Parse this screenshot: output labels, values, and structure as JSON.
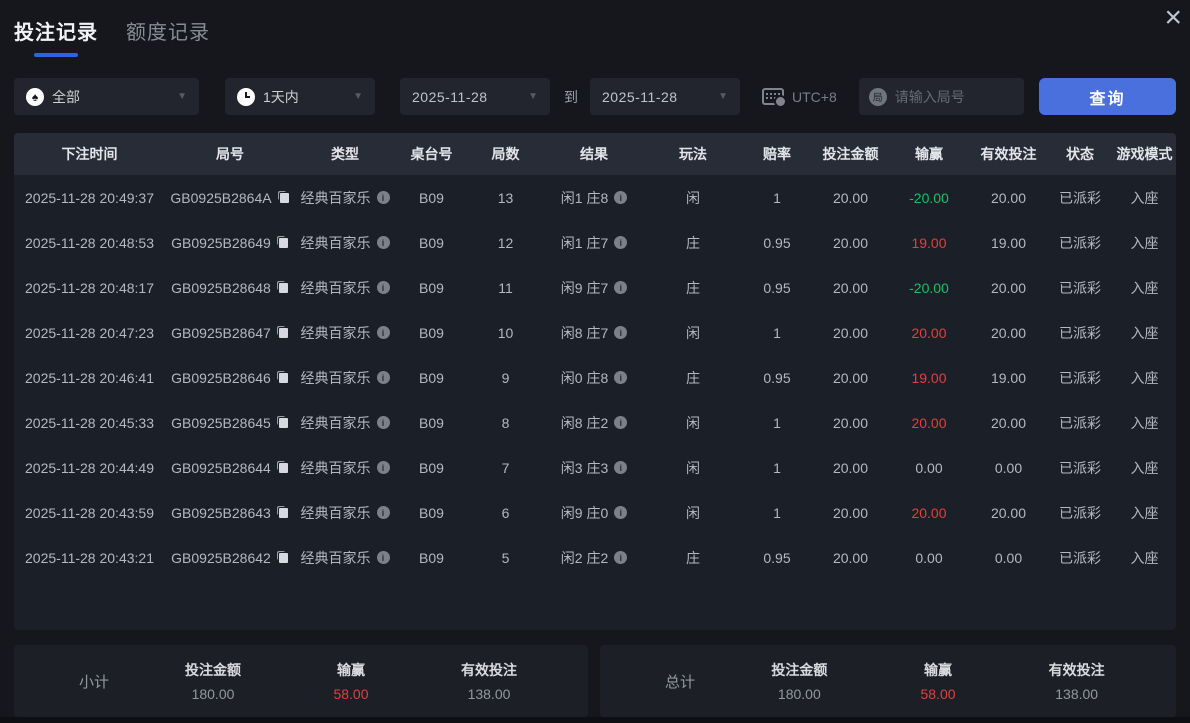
{
  "colors": {
    "accent_blue": "#4a70dd",
    "tab_underline": "#2e63e8",
    "win_red": "#e0413e",
    "loss_green": "#0fc367",
    "page_bg": "#16171d",
    "panel_bg": "#1b1f28",
    "header_bg": "#282c37"
  },
  "window": {
    "close_glyph": "×"
  },
  "tabs": [
    {
      "label": "投注记录",
      "active": true
    },
    {
      "label": "额度记录",
      "active": false
    }
  ],
  "filters": {
    "game_type": {
      "icon_glyph": "♠",
      "value": "全部"
    },
    "time_range": {
      "value": "1天内"
    },
    "date_from": "2025-11-28",
    "to_label": "到",
    "date_to": "2025-11-28",
    "timezone_label": "UTC+8",
    "round_input": {
      "badge_glyph": "局",
      "placeholder": "请输入局号",
      "value": ""
    },
    "query_button": "查询",
    "caret_glyph": "▼",
    "info_glyph": "i"
  },
  "table": {
    "columns": [
      "下注时间",
      "局号",
      "类型",
      "桌台号",
      "局数",
      "结果",
      "玩法",
      "赔率",
      "投注金额",
      "输赢",
      "有效投注",
      "状态",
      "游戏模式"
    ],
    "rows": [
      {
        "time": "2025-11-28 20:49:37",
        "round_id": "GB0925B2864A",
        "type": "经典百家乐",
        "table_no": "B09",
        "round_no": "13",
        "result": "闲1 庄8",
        "play": "闲",
        "odds": "1",
        "bet": "20.00",
        "win_loss": "-20.00",
        "win_loss_color": "green",
        "valid_bet": "20.00",
        "status": "已派彩",
        "mode": "入座"
      },
      {
        "time": "2025-11-28 20:48:53",
        "round_id": "GB0925B28649",
        "type": "经典百家乐",
        "table_no": "B09",
        "round_no": "12",
        "result": "闲1 庄7",
        "play": "庄",
        "odds": "0.95",
        "bet": "20.00",
        "win_loss": "19.00",
        "win_loss_color": "red",
        "valid_bet": "19.00",
        "status": "已派彩",
        "mode": "入座"
      },
      {
        "time": "2025-11-28 20:48:17",
        "round_id": "GB0925B28648",
        "type": "经典百家乐",
        "table_no": "B09",
        "round_no": "11",
        "result": "闲9 庄7",
        "play": "庄",
        "odds": "0.95",
        "bet": "20.00",
        "win_loss": "-20.00",
        "win_loss_color": "green",
        "valid_bet": "20.00",
        "status": "已派彩",
        "mode": "入座"
      },
      {
        "time": "2025-11-28 20:47:23",
        "round_id": "GB0925B28647",
        "type": "经典百家乐",
        "table_no": "B09",
        "round_no": "10",
        "result": "闲8 庄7",
        "play": "闲",
        "odds": "1",
        "bet": "20.00",
        "win_loss": "20.00",
        "win_loss_color": "red",
        "valid_bet": "20.00",
        "status": "已派彩",
        "mode": "入座"
      },
      {
        "time": "2025-11-28 20:46:41",
        "round_id": "GB0925B28646",
        "type": "经典百家乐",
        "table_no": "B09",
        "round_no": "9",
        "result": "闲0 庄8",
        "play": "庄",
        "odds": "0.95",
        "bet": "20.00",
        "win_loss": "19.00",
        "win_loss_color": "red",
        "valid_bet": "19.00",
        "status": "已派彩",
        "mode": "入座"
      },
      {
        "time": "2025-11-28 20:45:33",
        "round_id": "GB0925B28645",
        "type": "经典百家乐",
        "table_no": "B09",
        "round_no": "8",
        "result": "闲8 庄2",
        "play": "闲",
        "odds": "1",
        "bet": "20.00",
        "win_loss": "20.00",
        "win_loss_color": "red",
        "valid_bet": "20.00",
        "status": "已派彩",
        "mode": "入座"
      },
      {
        "time": "2025-11-28 20:44:49",
        "round_id": "GB0925B28644",
        "type": "经典百家乐",
        "table_no": "B09",
        "round_no": "7",
        "result": "闲3 庄3",
        "play": "闲",
        "odds": "1",
        "bet": "20.00",
        "win_loss": "0.00",
        "win_loss_color": "neutral",
        "valid_bet": "0.00",
        "status": "已派彩",
        "mode": "入座"
      },
      {
        "time": "2025-11-28 20:43:59",
        "round_id": "GB0925B28643",
        "type": "经典百家乐",
        "table_no": "B09",
        "round_no": "6",
        "result": "闲9 庄0",
        "play": "闲",
        "odds": "1",
        "bet": "20.00",
        "win_loss": "20.00",
        "win_loss_color": "red",
        "valid_bet": "20.00",
        "status": "已派彩",
        "mode": "入座"
      },
      {
        "time": "2025-11-28 20:43:21",
        "round_id": "GB0925B28642",
        "type": "经典百家乐",
        "table_no": "B09",
        "round_no": "5",
        "result": "闲2 庄2",
        "play": "庄",
        "odds": "0.95",
        "bet": "20.00",
        "win_loss": "0.00",
        "win_loss_color": "neutral",
        "valid_bet": "0.00",
        "status": "已派彩",
        "mode": "入座"
      }
    ]
  },
  "summary": {
    "labels": {
      "bet": "投注金额",
      "win": "输赢",
      "valid": "有效投注"
    },
    "subtotal": {
      "title": "小计",
      "bet": "180.00",
      "win": "58.00",
      "valid": "138.00"
    },
    "total": {
      "title": "总计",
      "bet": "180.00",
      "win": "58.00",
      "valid": "138.00"
    }
  }
}
